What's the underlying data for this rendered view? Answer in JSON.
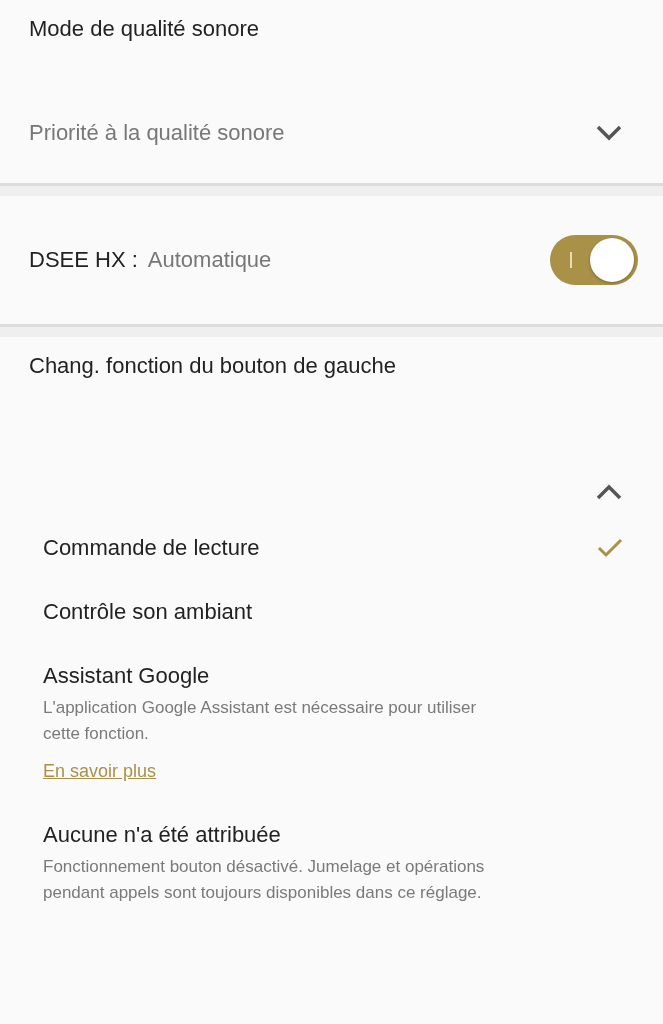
{
  "sound_quality": {
    "title": "Mode de qualité sonore",
    "value": "Priorité à la qualité sonore",
    "expanded": false
  },
  "dsee": {
    "label": "DSEE HX :",
    "value": "Automatique",
    "on": true
  },
  "left_button": {
    "title": "Chang. fonction du bouton de gauche",
    "expanded": true,
    "options": [
      {
        "label": "Commande de lecture",
        "selected": true
      },
      {
        "label": "Contrôle son ambiant",
        "selected": false
      },
      {
        "label": "Assistant Google",
        "selected": false,
        "description": "L'application Google Assistant est nécessaire pour utiliser cette fonction.",
        "link": "En savoir plus"
      },
      {
        "label": "Aucune n'a été attribuée",
        "selected": false,
        "description": "Fonctionnement bouton désactivé. Jumelage et opérations pendant appels sont toujours disponibles dans ce réglage."
      }
    ]
  }
}
